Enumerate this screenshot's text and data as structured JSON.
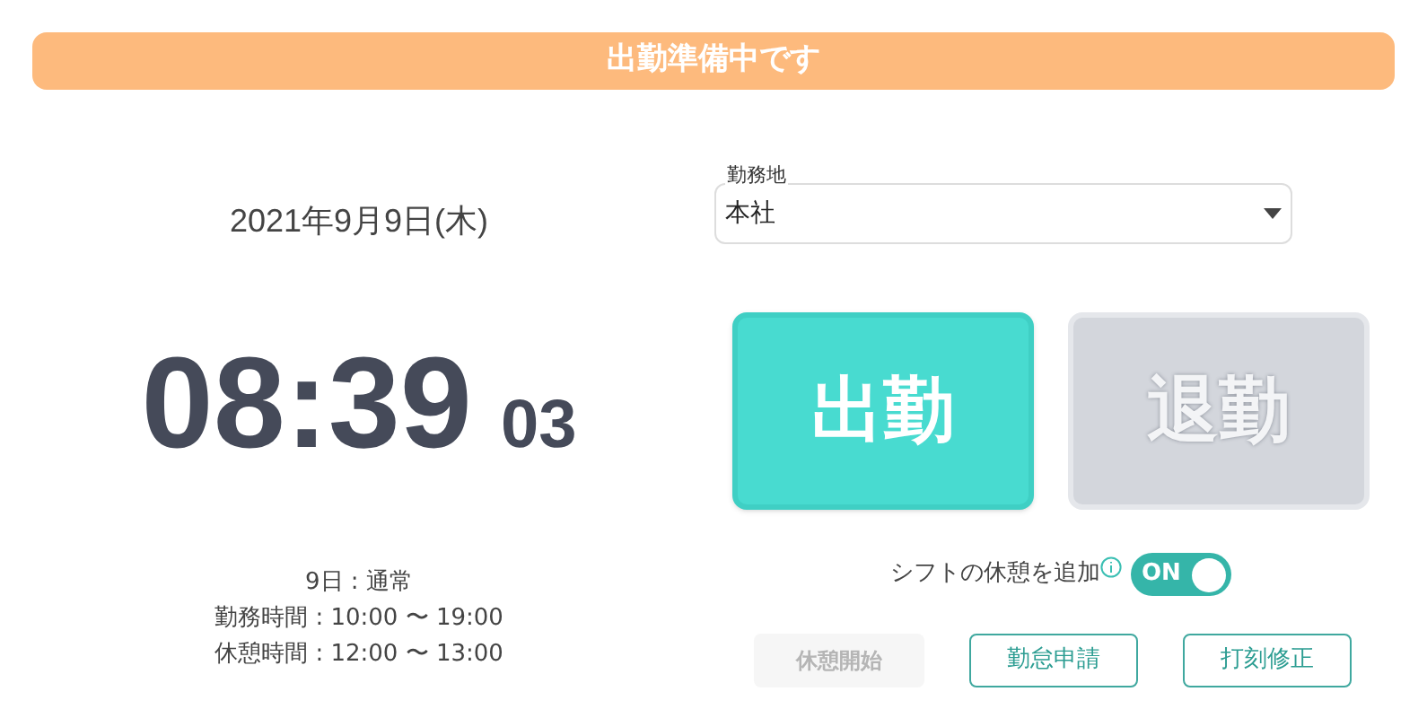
{
  "banner": {
    "title": "出勤準備中です"
  },
  "date": "2021年9月9日(木)",
  "clock": {
    "hours_minutes": "08:39",
    "seconds": "03"
  },
  "shift_info": [
    "9日 : 通常",
    "勤務時間 : 10:00 〜 19:00",
    "休憩時間 : 12:00 〜 13:00"
  ],
  "workplace": {
    "label": "勤務地",
    "value": "本社"
  },
  "punch_buttons": [
    {
      "label": "出勤",
      "disabled": false
    },
    {
      "label": "退勤",
      "disabled": true
    }
  ],
  "shift_break_toggle": {
    "label": "シフトの休憩を追加",
    "on": true,
    "on_text": "ON"
  },
  "actions": [
    {
      "label": "休憩開始",
      "disabled": true
    },
    {
      "label": "勤怠申請",
      "disabled": false
    },
    {
      "label": "打刻修正",
      "disabled": false
    }
  ]
}
